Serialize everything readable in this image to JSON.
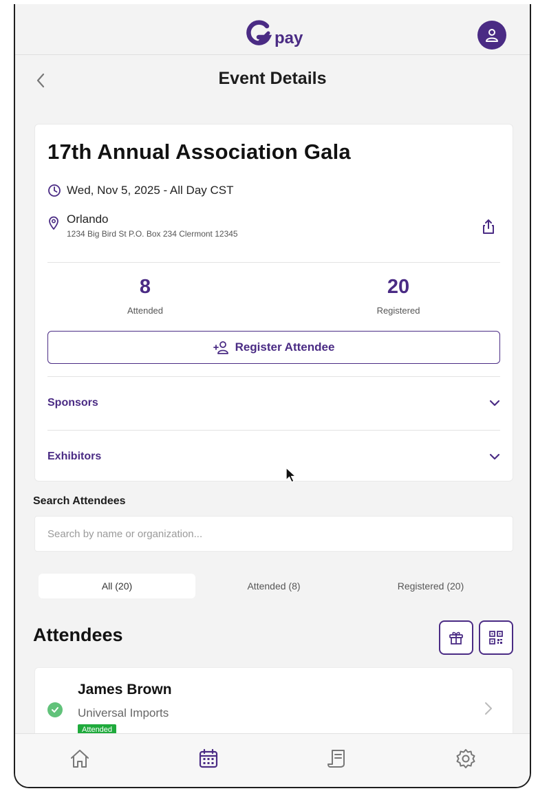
{
  "brand": {
    "logo_text": "pay",
    "accent_color": "#4a2b84"
  },
  "header": {
    "title": "Event Details"
  },
  "event": {
    "title": "17th Annual Association Gala",
    "date": "Wed, Nov 5, 2025 - All Day CST",
    "location_city": "Orlando",
    "location_address": "1234 Big Bird St P.O. Box 234 Clermont  12345",
    "stats": {
      "attended_count": "8",
      "attended_label": "Attended",
      "registered_count": "20",
      "registered_label": "Registered"
    },
    "register_button_label": "Register Attendee",
    "accordions": {
      "sponsors_label": "Sponsors",
      "exhibitors_label": "Exhibitors"
    }
  },
  "search": {
    "label": "Search Attendees",
    "placeholder": "Search by name or organization..."
  },
  "tabs": {
    "all": "All (20)",
    "attended": "Attended (8)",
    "registered": "Registered (20)",
    "active": "all"
  },
  "attendees": {
    "title": "Attendees",
    "items": [
      {
        "name": "James Brown",
        "organization": "Universal Imports",
        "status": "Attended",
        "status_color": "#1faa3c"
      }
    ]
  },
  "icons": {
    "profile": "user-icon",
    "back": "chevron-left-icon",
    "calendar_clock": "clock-icon",
    "location": "map-pin-icon",
    "share": "share-icon",
    "add_user": "user-plus-icon",
    "gift": "gift-icon",
    "qr": "qr-code-icon",
    "nav_home": "home-icon",
    "nav_events": "calendar-icon",
    "nav_receipts": "receipt-icon",
    "nav_settings": "gear-icon"
  }
}
